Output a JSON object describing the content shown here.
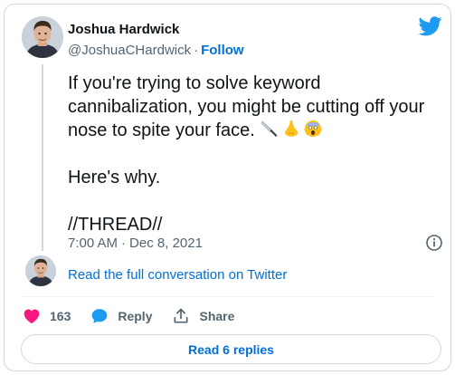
{
  "author": {
    "name": "Joshua Hardwick",
    "handle": "@JoshuaCHardwick",
    "dot": "·",
    "follow_label": "Follow",
    "avatar_icon": "user-avatar-icon"
  },
  "tweet": {
    "text": "If you're trying to solve keyword cannibalization, you might be cutting off your nose to spite your face.",
    "emojis": [
      "knife-emoji",
      "nose-emoji",
      "scream-emoji"
    ],
    "paragraph2": "Here's why.",
    "paragraph3": "//THREAD//",
    "time": "7:00 AM",
    "date_sep": "·",
    "date": "Dec 8, 2021"
  },
  "conversation": {
    "read_full_label": "Read the full conversation on Twitter"
  },
  "actions": {
    "like_count": "163",
    "reply_label": "Reply",
    "share_label": "Share"
  },
  "replies": {
    "button_label": "Read 6 replies"
  },
  "colors": {
    "accent": "#1d9bf0",
    "link": "#006fd6",
    "like": "#f91880",
    "muted": "#536471",
    "text": "#0f1419",
    "border": "#cfd9de"
  }
}
